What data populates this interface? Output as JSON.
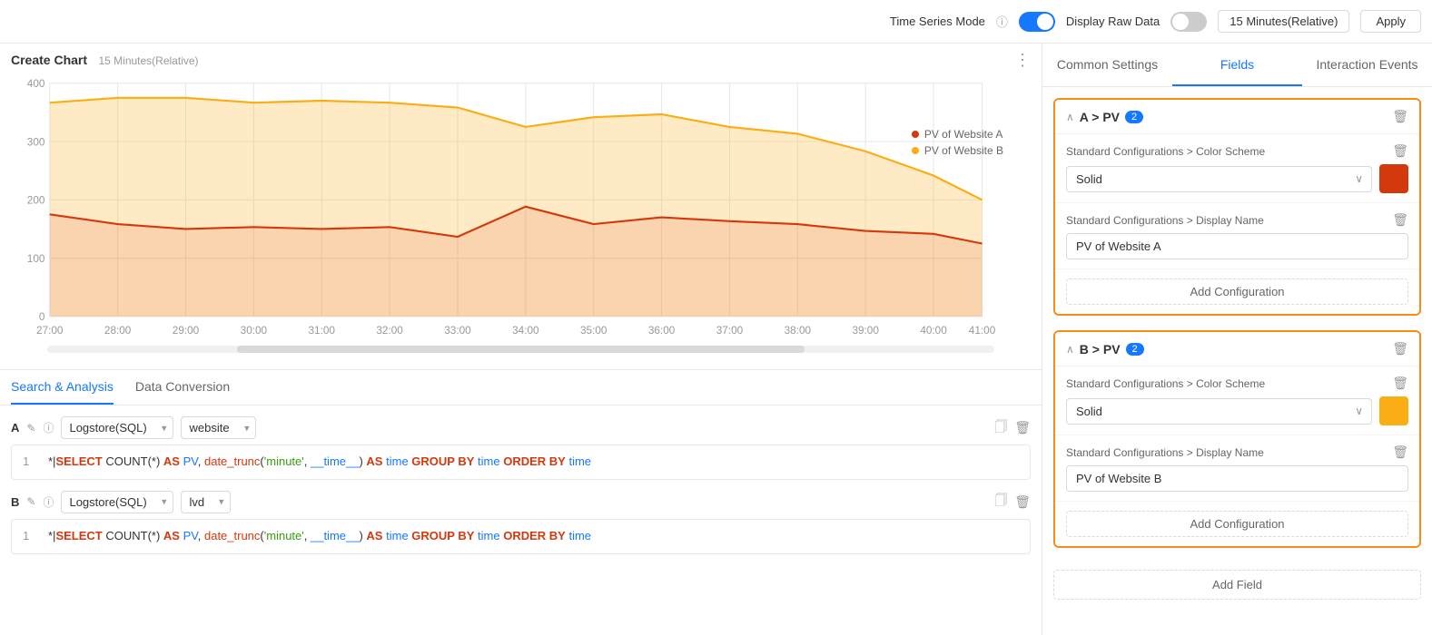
{
  "topbar": {
    "time_series_label": "Time Series Mode",
    "display_raw_label": "Display Raw Data",
    "time_range": "15 Minutes(Relative)",
    "apply_label": "Apply",
    "time_series_on": true,
    "display_raw_on": false
  },
  "chart": {
    "title": "Create Chart",
    "subtitle": "15 Minutes(Relative)",
    "legend": [
      {
        "label": "PV of Website A",
        "color": "#d4380d"
      },
      {
        "label": "PV of Website B",
        "color": "#faad14"
      }
    ],
    "x_labels": [
      "27:00",
      "28:00",
      "29:00",
      "30:00",
      "31:00",
      "32:00",
      "33:00",
      "34:00",
      "35:00",
      "36:00",
      "37:00",
      "38:00",
      "39:00",
      "40:00",
      "41:00"
    ],
    "y_labels": [
      "400",
      "300",
      "200",
      "100",
      "0"
    ]
  },
  "tabs": {
    "left": [
      {
        "label": "Search & Analysis",
        "active": true
      },
      {
        "label": "Data Conversion",
        "active": false
      }
    ]
  },
  "queries": [
    {
      "label": "A",
      "store_type": "Logstore(SQL)",
      "store_name": "website",
      "code": "1  *|SELECT COUNT(*) AS PV, date_trunc('minute', __time__) AS time GROUP BY time ORDER BY time"
    },
    {
      "label": "B",
      "store_type": "Logstore(SQL)",
      "store_name": "lvd",
      "code": "1  *|SELECT COUNT(*) AS PV, date_trunc('minute', __time__) AS time GROUP BY time ORDER BY time"
    }
  ],
  "right_panel": {
    "tabs": [
      {
        "label": "Common Settings",
        "active": false
      },
      {
        "label": "Fields",
        "active": true
      },
      {
        "label": "Interaction Events",
        "active": false
      }
    ],
    "fields": [
      {
        "name": "A > PV",
        "badge": "2",
        "configs": [
          {
            "section_label": "Standard Configurations > Color Scheme",
            "type": "select_color",
            "select_value": "Solid",
            "color": "#d4380d"
          },
          {
            "section_label": "Standard Configurations > Display Name",
            "type": "text",
            "value": "PV of Website A"
          }
        ],
        "add_config_label": "Add Configuration"
      },
      {
        "name": "B > PV",
        "badge": "2",
        "configs": [
          {
            "section_label": "Standard Configurations > Color Scheme",
            "type": "select_color",
            "select_value": "Solid",
            "color": "#faad14"
          },
          {
            "section_label": "Standard Configurations > Display Name",
            "type": "text",
            "value": "PV of Website B"
          }
        ],
        "add_config_label": "Add Configuration"
      }
    ],
    "add_field_label": "Add Field"
  }
}
